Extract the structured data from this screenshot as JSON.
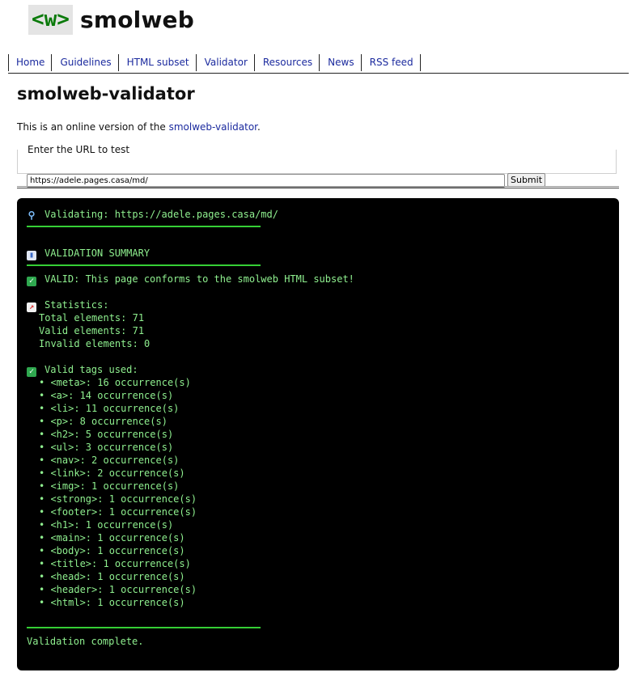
{
  "site": {
    "logo": "<w>",
    "name": "smolweb"
  },
  "nav": [
    {
      "label": "Home"
    },
    {
      "label": "Guidelines"
    },
    {
      "label": "HTML subset"
    },
    {
      "label": "Validator"
    },
    {
      "label": "Resources"
    },
    {
      "label": "News"
    },
    {
      "label": "RSS feed"
    }
  ],
  "page": {
    "title": "smolweb-validator",
    "intro_text": "This is an online version of the ",
    "intro_link": "smolweb-validator",
    "intro_end": "."
  },
  "form": {
    "legend": "Enter the URL to test",
    "url_value": "https://adele.pages.casa/md/",
    "submit_label": "Submit"
  },
  "output": {
    "validating": "Validating: https://adele.pages.casa/md/",
    "summary_title": "VALIDATION SUMMARY",
    "valid_message": "VALID: This page conforms to the smolweb HTML subset!",
    "stats_title": "Statistics:",
    "stats": [
      "Total elements: 71",
      "Valid elements: 71",
      "Invalid elements: 0"
    ],
    "tags_title": "Valid tags used:",
    "tags": [
      "• <meta>: 16 occurrence(s)",
      "• <a>: 14 occurrence(s)",
      "• <li>: 11 occurrence(s)",
      "• <p>: 8 occurrence(s)",
      "• <h2>: 5 occurrence(s)",
      "• <ul>: 3 occurrence(s)",
      "• <nav>: 2 occurrence(s)",
      "• <link>: 2 occurrence(s)",
      "• <img>: 1 occurrence(s)",
      "• <strong>: 1 occurrence(s)",
      "• <footer>: 1 occurrence(s)",
      "• <h1>: 1 occurrence(s)",
      "• <main>: 1 occurrence(s)",
      "• <body>: 1 occurrence(s)",
      "• <title>: 1 occurrence(s)",
      "• <head>: 1 occurrence(s)",
      "• <header>: 1 occurrence(s)",
      "• <html>: 1 occurrence(s)"
    ],
    "complete": "Validation complete."
  },
  "icons": {
    "validating": "magnifier-icon",
    "summary": "bar-chart-icon",
    "valid": "check-mark-icon",
    "stats": "trend-chart-icon",
    "tags": "check-mark-icon"
  },
  "colors": {
    "terminal_bg": "#000000",
    "terminal_text": "#8ff08f",
    "separator": "#35cf35",
    "link": "#1b2a9e",
    "logo_text": "#0a7a0a"
  }
}
